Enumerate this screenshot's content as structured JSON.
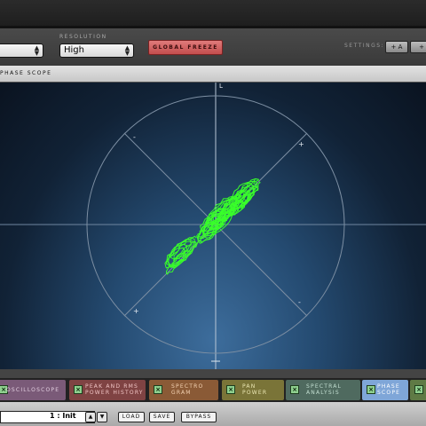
{
  "toolbar": {
    "left_select_value": "",
    "resolution_label": "RESOLUTION",
    "resolution_value": "High",
    "global_freeze_label": "GLOBAL FREEZE",
    "settings_label": "SETTINGS:",
    "settings_buttons": [
      "A",
      ""
    ]
  },
  "panel": {
    "title": "PHASE SCOPE",
    "axis_top_label": "L",
    "quadrant_labels": [
      "-",
      "+",
      "+",
      "-"
    ]
  },
  "tabs": [
    {
      "label_line1": "OSCILLOSCOPE",
      "label_line2": "",
      "color": "#7a5a78",
      "active": false
    },
    {
      "label_line1": "PEAK AND RMS",
      "label_line2": "POWER HISTORY",
      "color": "#7f4343",
      "active": false
    },
    {
      "label_line1": "SPECTRO",
      "label_line2": "GRAM",
      "color": "#8a5a36",
      "active": false
    },
    {
      "label_line1": "PAN",
      "label_line2": "POWER",
      "color": "#7a7438",
      "active": false
    },
    {
      "label_line1": "SPECTRAL",
      "label_line2": "ANALYSIS",
      "color": "#4f6a5f",
      "active": false
    },
    {
      "label_line1": "PHASE",
      "label_line2": "SCOPE",
      "color": "#7fa6d8",
      "active": true
    }
  ],
  "bottom": {
    "preset_value": "1 : Init",
    "load_label": "LOAD",
    "save_label": "SAVE",
    "bypass_label": "BYPASS"
  },
  "colors": {
    "trace": "#39ff2a",
    "freeze": "#d05f5f",
    "active_tab": "#7fa6d8"
  }
}
